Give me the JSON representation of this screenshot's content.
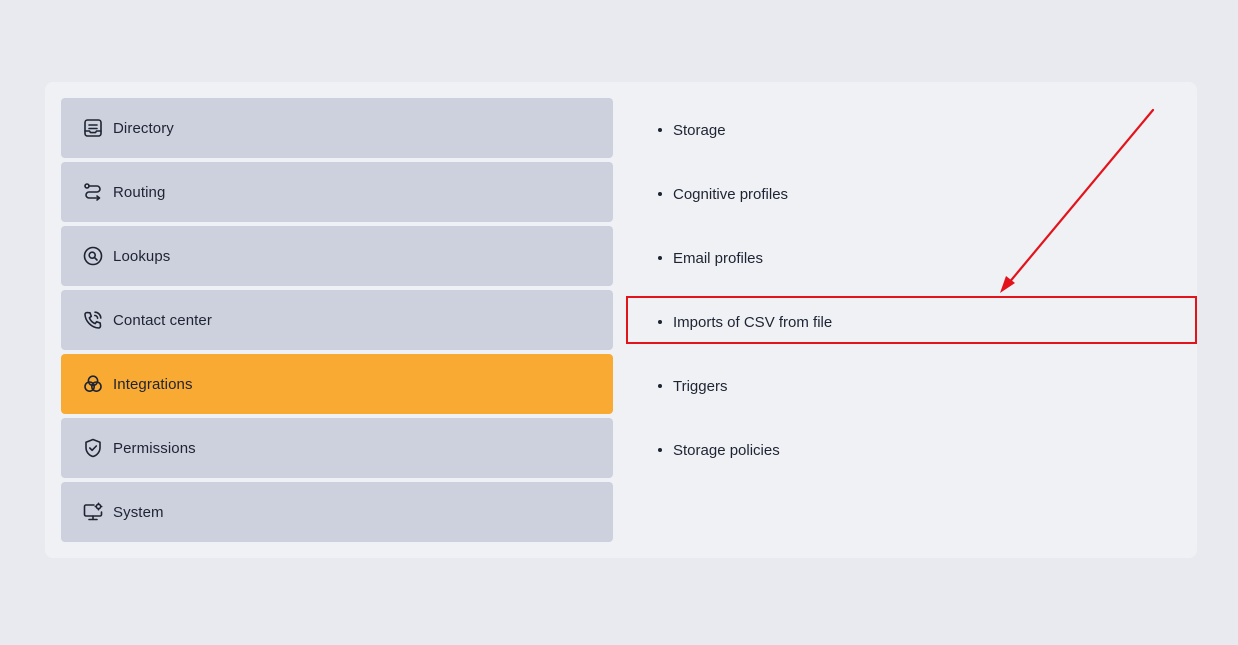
{
  "sidebar": {
    "items": [
      {
        "label": "Directory",
        "icon": "directory-icon",
        "active": false
      },
      {
        "label": "Routing",
        "icon": "routing-icon",
        "active": false
      },
      {
        "label": "Lookups",
        "icon": "lookups-icon",
        "active": false
      },
      {
        "label": "Contact center",
        "icon": "contact-center-icon",
        "active": false
      },
      {
        "label": "Integrations",
        "icon": "integrations-icon",
        "active": true
      },
      {
        "label": "Permissions",
        "icon": "permissions-icon",
        "active": false
      },
      {
        "label": "System",
        "icon": "system-icon",
        "active": false
      }
    ]
  },
  "submenu": {
    "items": [
      {
        "label": "Storage"
      },
      {
        "label": "Cognitive profiles"
      },
      {
        "label": "Email profiles"
      },
      {
        "label": "Imports of CSV from file",
        "highlighted": true
      },
      {
        "label": "Triggers"
      },
      {
        "label": "Storage policies"
      }
    ]
  },
  "colors": {
    "page_background": "#e9eaef",
    "panel_background": "#f0f1f5",
    "item_background": "#cdd0dd",
    "active_item_background": "#f9aa33",
    "annotation": "#e3131b",
    "text": "#1e2433"
  }
}
